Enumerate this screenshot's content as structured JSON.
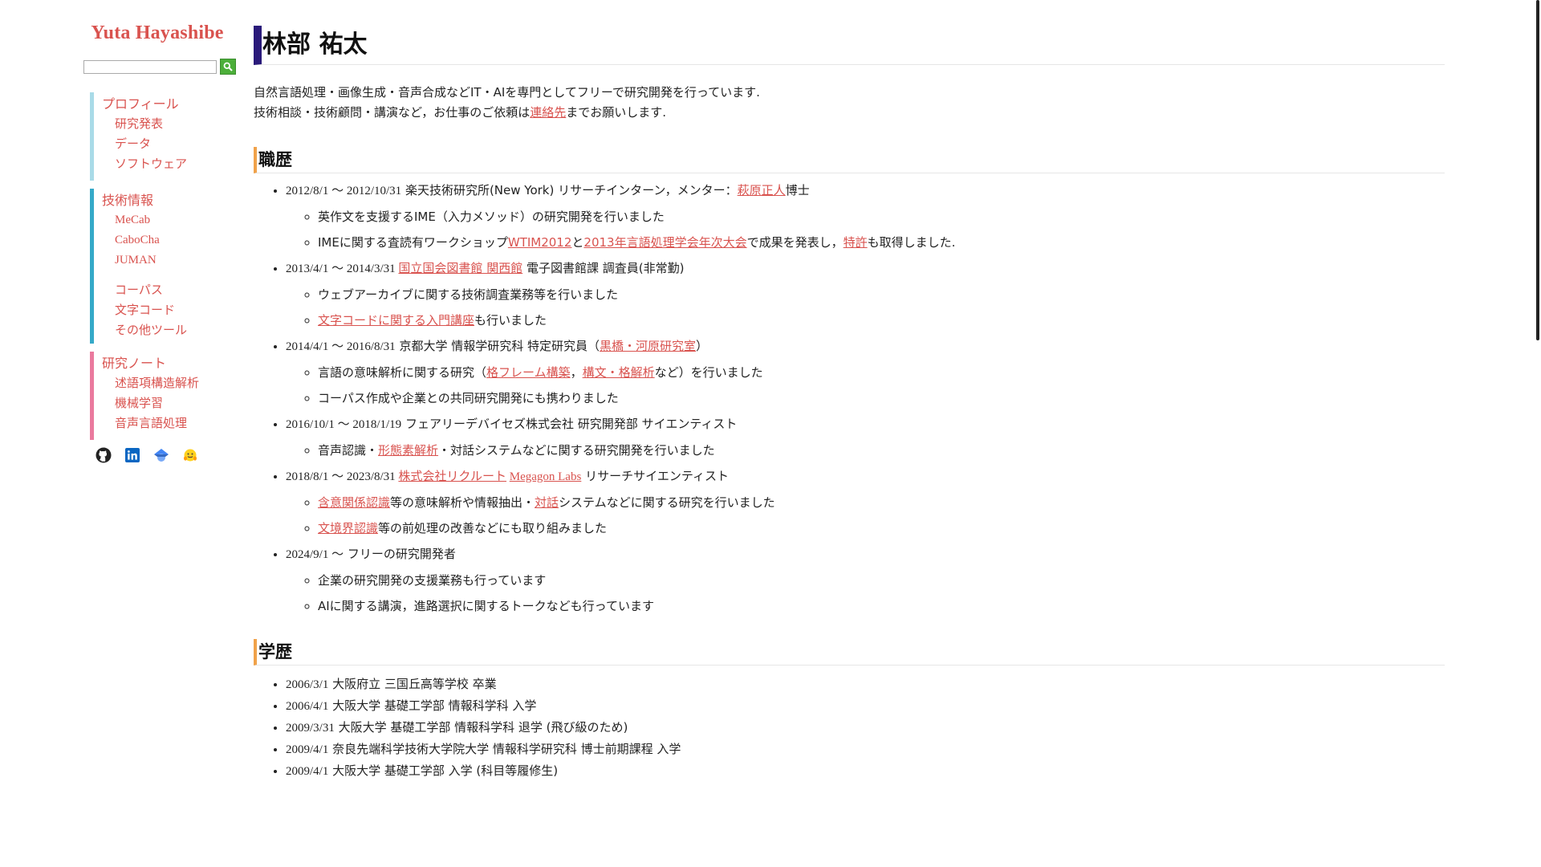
{
  "sidebar": {
    "site_title": "Yuta Hayashibe",
    "search": {
      "placeholder": "",
      "value": ""
    },
    "group1": {
      "main": "プロフィール",
      "items": [
        "研究発表",
        "データ",
        "ソフトウェア"
      ]
    },
    "group2": {
      "main": "技術情報",
      "items_a": [
        "MeCab",
        "CaboCha",
        "JUMAN"
      ],
      "items_b": [
        "コーパス",
        "文字コード",
        "その他ツール"
      ]
    },
    "group3": {
      "main": "研究ノート",
      "items": [
        "述語項構造解析",
        "機械学習",
        "音声言語処理"
      ]
    },
    "social_icons": [
      "github-icon",
      "linkedin-icon",
      "google-scholar-icon",
      "huggingface-icon"
    ]
  },
  "main": {
    "title": "林部 祐太",
    "intro": [
      "自然言語処理・画像生成・音声合成などIT・AIを専門としてフリーで研究開発を行っています.",
      "技術相談・技術顧問・講演など，お仕事のご依頼は",
      "連絡先",
      "までお願いします."
    ],
    "career": {
      "heading": "職歴",
      "e1": {
        "date": "2012/8/1 〜 2012/10/31",
        "t1": " 楽天技術研究所(New York) リサーチインターン，メンター：",
        "link": "萩原正人",
        "t2": "博士",
        "s1": "英作文を支援するIME（入力メソッド）の研究開発を行いました",
        "s2": [
          "IMEに関する査読有ワークショップ",
          "WTIM2012",
          "と",
          "2013年言語処理学会年次大会",
          "で成果を発表し，",
          "特許",
          "も取得しました."
        ]
      },
      "e2": {
        "date": "2013/4/1 〜 2014/3/31",
        "link": "国立国会図書館 関西館",
        "t": " 電子図書館課 調査員(非常勤)",
        "s1": "ウェブアーカイブに関する技術調査業務等を行いました",
        "s2_link": "文字コードに関する入門講座",
        "s2_t": "も行いました"
      },
      "e3": {
        "date": "2014/4/1 〜 2016/8/31",
        "t": " 京都大学 情報学研究科 特定研究員（",
        "link": "黒橋・河原研究室",
        "t_end": "）",
        "s1": [
          "言語の意味解析に関する研究（",
          "格フレーム構築",
          "，",
          "構文・格解析",
          "など）を行いました"
        ],
        "s2": "コーパス作成や企業との共同研究開発にも携わりました"
      },
      "e4": {
        "date": "2016/10/1 〜 2018/1/19",
        "t": " フェアリーデバイセズ株式会社 研究開発部 サイエンティスト",
        "s1": [
          "音声認識・",
          "形態素解析",
          "・対話システムなどに関する研究開発を行いました"
        ]
      },
      "e5": {
        "date": "2018/8/1 〜 2023/8/31",
        "link1": "株式会社リクルート",
        "link2": "Megagon Labs",
        "t": " リサーチサイエンティスト",
        "s1": [
          "含意関係認識",
          "等の意味解析や情報抽出・",
          "対話",
          "システムなどに関する研究を行いました"
        ],
        "s2": [
          "文境界認識",
          "等の前処理の改善などにも取り組みました"
        ]
      },
      "e6": {
        "date": "2024/9/1 〜",
        "t": " フリーの研究開発者",
        "s1": "企業の研究開発の支援業務も行っています",
        "s2": "AIに関する講演，進路選択に関するトークなども行っています"
      }
    },
    "education": {
      "heading": "学歴",
      "items": [
        {
          "date": "2006/3/1",
          "t": " 大阪府立 三国丘高等学校 卒業"
        },
        {
          "date": "2006/4/1",
          "t": " 大阪大学 基礎工学部 情報科学科 入学"
        },
        {
          "date": "2009/3/31",
          "t": " 大阪大学 基礎工学部 情報科学科 退学 (飛び級のため)"
        },
        {
          "date": "2009/4/1",
          "t": " 奈良先端科学技術大学院大学 情報科学研究科 博士前期課程 入学"
        },
        {
          "date": "2009/4/1",
          "t": " 大阪大学 基礎工学部 入学 (科目等履修生)"
        }
      ]
    }
  }
}
